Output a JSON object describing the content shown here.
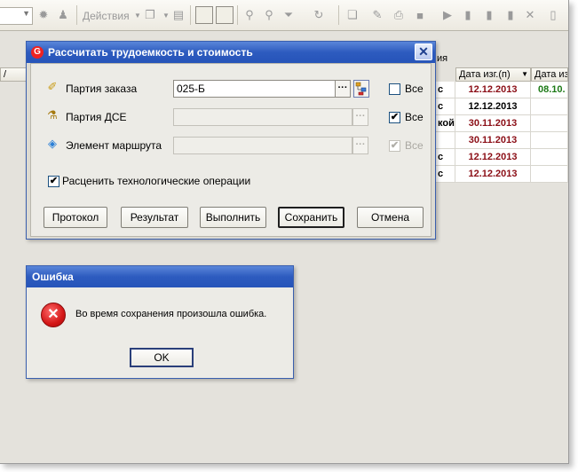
{
  "toolbar": {
    "actions_label": "Действия"
  },
  "grid": {
    "header_fragment": "ия",
    "col_headers": [
      "Дата изг.(п)",
      "Дата изг"
    ],
    "rows": [
      {
        "side": "с",
        "date": "12.12.2013",
        "date_color": "red",
        "extra": "08.10."
      },
      {
        "side": "с",
        "date": "12.12.2013",
        "date_color": "black",
        "extra": ""
      },
      {
        "side": "кой",
        "date": "30.11.2013",
        "date_color": "red",
        "extra": ""
      },
      {
        "side": "",
        "date": "30.11.2013",
        "date_color": "red",
        "extra": ""
      },
      {
        "side": "с",
        "date": "12.12.2013",
        "date_color": "red",
        "extra": ""
      },
      {
        "side": "с",
        "date": "12.12.2013",
        "date_color": "red",
        "extra": ""
      }
    ]
  },
  "dialog": {
    "title": "Рассчитать трудоемкость и стоимость",
    "close_glyph": "✕",
    "fields": {
      "order_batch": {
        "label": "Партия заказа",
        "value": "025-Б",
        "all_label": "Все",
        "all_checked": false
      },
      "dse_batch": {
        "label": "Партия ДСЕ",
        "value": "",
        "all_label": "Все",
        "all_checked": true
      },
      "route_element": {
        "label": "Элемент маршрута",
        "value": "",
        "all_label": "Все",
        "all_checked": true,
        "disabled": true
      }
    },
    "price_ops": {
      "label": "Расценить технологические операции",
      "checked": true
    },
    "buttons": {
      "protocol": "Протокол",
      "result": "Результат",
      "execute": "Выполнить",
      "save": "Сохранить",
      "cancel": "Отмена"
    }
  },
  "error": {
    "title": "Ошибка",
    "message": "Во время сохранения произошла ошибка.",
    "ok": "OK"
  },
  "colors": {
    "title_bar": "#2d5bbf",
    "date_red": "#8b0e16",
    "date_green": "#1d7a16"
  }
}
